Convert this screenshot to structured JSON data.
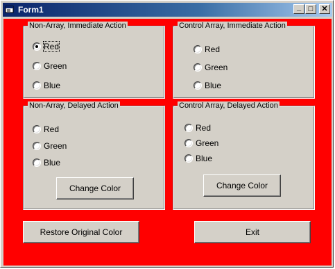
{
  "window": {
    "title": "Form1",
    "minimize": "_",
    "maximize": "□",
    "close": "✕"
  },
  "frames": [
    {
      "title": "Non-Array, Immediate Action",
      "options": [
        "Red",
        "Green",
        "Blue"
      ],
      "selected": "Red"
    },
    {
      "title": "Control Array, Immediate Action",
      "options": [
        "Red",
        "Green",
        "Blue"
      ],
      "selected": ""
    },
    {
      "title": "Non-Array, Delayed Action",
      "options": [
        "Red",
        "Green",
        "Blue"
      ],
      "selected": "",
      "button": "Change Color"
    },
    {
      "title": "Control Array, Delayed Action",
      "options": [
        "Red",
        "Green",
        "Blue"
      ],
      "selected": "",
      "button": "Change Color"
    }
  ],
  "buttons": {
    "restore": "Restore Original Color",
    "exit": "Exit"
  },
  "colors": {
    "form_background": "#ff0000",
    "titlebar_start": "#0a246a",
    "titlebar_end": "#a6caf0",
    "control_face": "#d4d0c8"
  }
}
